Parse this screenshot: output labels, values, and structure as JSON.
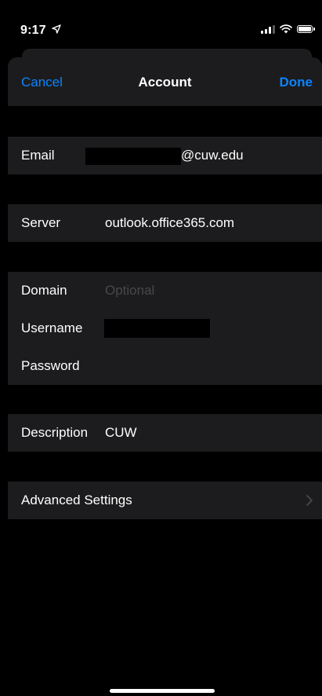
{
  "status_bar": {
    "time": "9:17",
    "location_icon": "location-arrow-icon",
    "signal_icon": "cellular-signal-icon",
    "wifi_icon": "wifi-icon",
    "battery_icon": "battery-icon"
  },
  "nav": {
    "cancel_label": "Cancel",
    "title": "Account",
    "done_label": "Done"
  },
  "fields": {
    "email": {
      "label": "Email",
      "value_visible": "@cuw.edu"
    },
    "server": {
      "label": "Server",
      "value": "outlook.office365.com"
    },
    "domain": {
      "label": "Domain",
      "placeholder": "Optional"
    },
    "username": {
      "label": "Username"
    },
    "password": {
      "label": "Password"
    },
    "description": {
      "label": "Description",
      "value": "CUW"
    }
  },
  "advanced": {
    "label": "Advanced Settings",
    "chevron_icon": "chevron-right-icon"
  },
  "colors": {
    "accent": "#0a84ff",
    "background": "#000000",
    "cell_background": "#1c1c1e",
    "placeholder": "#48484a"
  }
}
